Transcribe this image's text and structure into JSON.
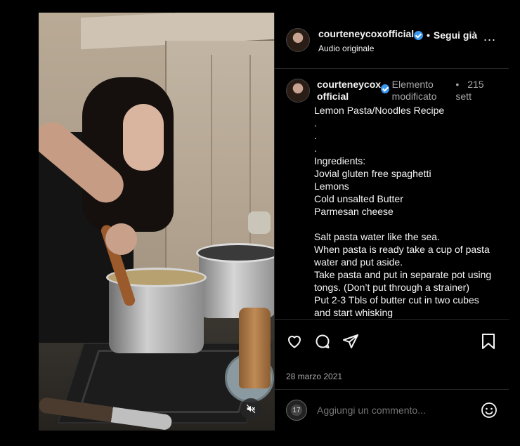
{
  "post": {
    "username": "courteneycoxofficial",
    "header_sub": "Audio originale",
    "follow_label": "Segui già",
    "separator": "•",
    "more_label": "..."
  },
  "caption": {
    "username": "courteneycox official",
    "edited_label": "Elemento modificato",
    "time": "215 sett",
    "body": "Lemon Pasta/Noodles Recipe\n.\n.\n.\nIngredients:\nJovial gluten free spaghetti\nLemons\nCold unsalted Butter\nParmesan cheese\n\nSalt pasta water like the sea.\nWhen pasta is ready take a cup of pasta water and put aside.\nTake pasta and put in separate pot using tongs. (Don’t put through a strainer)\nPut 2-3 Tbls of butter cut in two cubes and start whisking\nSqueeze in half a lemon"
  },
  "actions": {
    "like": "heart-icon",
    "comment": "comment-icon",
    "share": "share-icon",
    "save": "bookmark-icon"
  },
  "date": "28 marzo 2021",
  "comment_box": {
    "placeholder": "Aggiungi un commento...",
    "avatar_text": "17",
    "emoji_icon": "emoji-icon"
  },
  "media": {
    "mute_icon": "muted-speaker-icon"
  },
  "colors": {
    "background": "#000000",
    "verified": "#3897f0",
    "muted_text": "#a8a8a8"
  }
}
